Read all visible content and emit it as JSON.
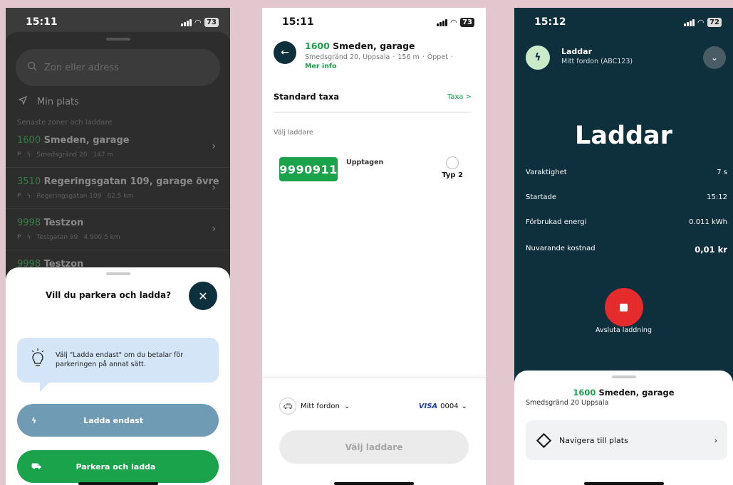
{
  "phone1": {
    "status": {
      "time": "15:11",
      "battery": "73"
    },
    "search": {
      "placeholder": "Zon eller adress"
    },
    "min_plats": "Min plats",
    "recent_label": "Senaste zoner och laddare",
    "zones": [
      {
        "code": "1600",
        "name": "Smeden, garage",
        "addr": "Smedsgränd 20",
        "dist": "147 m"
      },
      {
        "code": "3510",
        "name": "Regeringsgatan 109, garage övre...",
        "addr": "Regeringsgatan 109",
        "dist": "62.5 km"
      },
      {
        "code": "9998",
        "name": "Testzon",
        "addr": "Testgatan 99",
        "dist": "4 900.5 km"
      },
      {
        "code": "9998",
        "name": "Testzon",
        "addr": "",
        "dist": ""
      }
    ],
    "modal": {
      "title": "Vill du parkera och ladda?",
      "tip": "Välj \"Ladda endast\" om du betalar för parkeringen på annat sätt.",
      "btn_ladda": "Ladda endast",
      "btn_parkera": "Parkera och ladda"
    }
  },
  "phone2": {
    "status": {
      "time": "15:11",
      "battery": "73"
    },
    "zone": {
      "code": "1600",
      "name": "Smeden, garage",
      "addr": "Smedsgränd 20, Uppsala",
      "dist": "156 m",
      "state": "Öppet",
      "more": "Mer info"
    },
    "standard_taxa": "Standard taxa",
    "taxa_link": "Taxa >",
    "valj_label": "Välj laddare",
    "charger": {
      "id": "9990911",
      "status": "Upptagen",
      "type": "Typ 2"
    },
    "vehicle": "Mitt fordon",
    "card_brand": "VISA",
    "card_last": "0004",
    "select_button": "Välj laddare"
  },
  "phone3": {
    "status": {
      "time": "15:12",
      "battery": "72"
    },
    "header": {
      "title": "Laddar",
      "sub": "Mitt fordon (ABC123)"
    },
    "big": "Laddar",
    "stats": [
      {
        "label": "Varaktighet",
        "value": "7 s"
      },
      {
        "label": "Startade",
        "value": "15:12"
      },
      {
        "label": "Förbrukad energi",
        "value": "0.011 kWh"
      },
      {
        "label": "Nuvarande kostnad",
        "value": "0,01 kr"
      }
    ],
    "stop_label": "Avsluta laddning",
    "zone": {
      "code": "1600",
      "name": "Smeden, garage",
      "addr": "Smedsgränd 20 Uppsala"
    },
    "navigate": "Navigera till plats"
  },
  "colors": {
    "green": "#1aa34a",
    "navy": "#0e2f3c",
    "red": "#e52b2b",
    "blue_btn": "#6f9cb4",
    "tip_bg": "#d3e5f7"
  }
}
